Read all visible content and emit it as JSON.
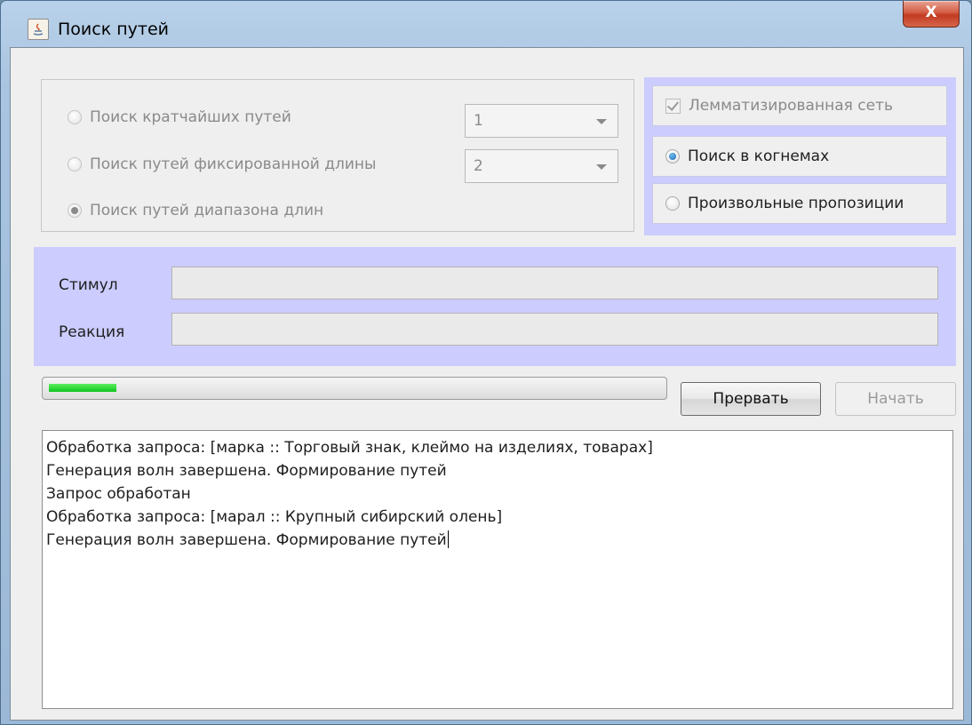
{
  "window": {
    "title": "Поиск путей",
    "close_label": "X"
  },
  "search_mode": {
    "options": [
      {
        "label": "Поиск кратчайших путей",
        "selected": false
      },
      {
        "label": "Поиск путей фиксированной длины",
        "selected": false
      },
      {
        "label": "Поиск путей диапазона длин",
        "selected": true
      }
    ],
    "combos": [
      {
        "value": "1"
      },
      {
        "value": "2"
      }
    ]
  },
  "options_panel": {
    "lemmatized": {
      "label": "Лемматизированная сеть",
      "checked": true,
      "enabled": false
    },
    "cognems": {
      "label": "Поиск в когнемах",
      "selected": true
    },
    "propositions": {
      "label": "Произвольные пропозиции",
      "selected": false
    }
  },
  "fields": {
    "stimulus": {
      "label": "Стимул",
      "value": ""
    },
    "reaction": {
      "label": "Реакция",
      "value": ""
    }
  },
  "progress": {
    "value": 0.11
  },
  "buttons": {
    "abort": "Прервать",
    "start": "Начать"
  },
  "log": {
    "lines": [
      "Обработка запроса: [марка :: Торговый знак, клеймо на изделиях, товарах]",
      "Генерация волн завершена. Формирование путей",
      "Запрос обработан",
      "Обработка запроса: [марал :: Крупный сибирский олень]",
      "Генерация волн завершена. Формирование путей"
    ]
  },
  "colors": {
    "panel_accent": "#ccccff",
    "progress_fill": "#1fd22a"
  }
}
